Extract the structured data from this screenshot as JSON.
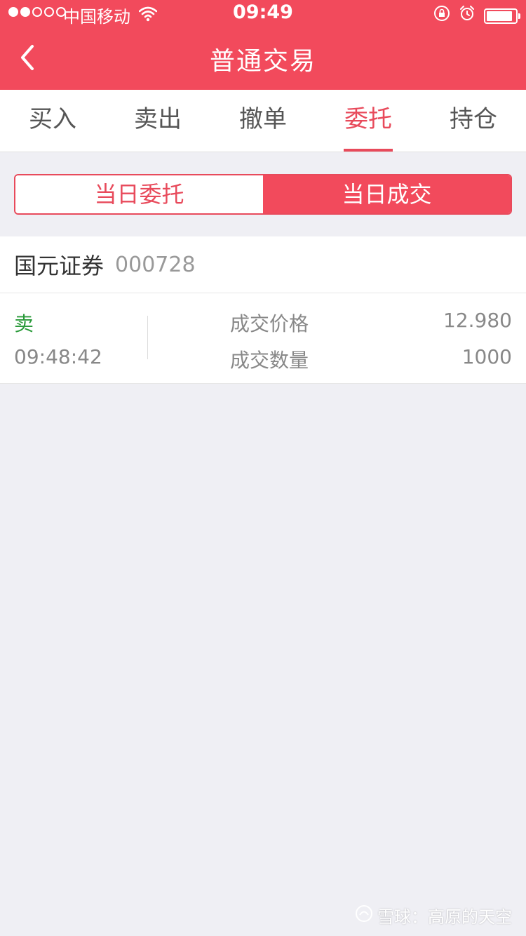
{
  "status_bar": {
    "carrier": "中国移动",
    "time": "09:49",
    "battery_level": 0.9
  },
  "nav": {
    "title": "普通交易"
  },
  "tabs": [
    {
      "label": "买入",
      "active": false
    },
    {
      "label": "卖出",
      "active": false
    },
    {
      "label": "撤单",
      "active": false
    },
    {
      "label": "委托",
      "active": true
    },
    {
      "label": "持仓",
      "active": false
    }
  ],
  "segment": {
    "left_label": "当日委托",
    "right_label": "当日成交",
    "active": "right"
  },
  "stock": {
    "name": "国元证券",
    "code": "000728"
  },
  "trade": {
    "side": "卖",
    "time": "09:48:42",
    "price_label": "成交价格",
    "price": "12.980",
    "qty_label": "成交数量",
    "qty": "1000"
  },
  "watermark": {
    "text": "雪球：高原的天空"
  },
  "colors": {
    "accent": "#f24a5c",
    "sell_green": "#2a9a3a",
    "background": "#efeff4"
  },
  "icons": {
    "back": "chevron-left-icon",
    "wifi": "wifi-icon",
    "lock": "rotation-lock-icon",
    "alarm": "alarm-icon",
    "battery": "battery-icon"
  }
}
